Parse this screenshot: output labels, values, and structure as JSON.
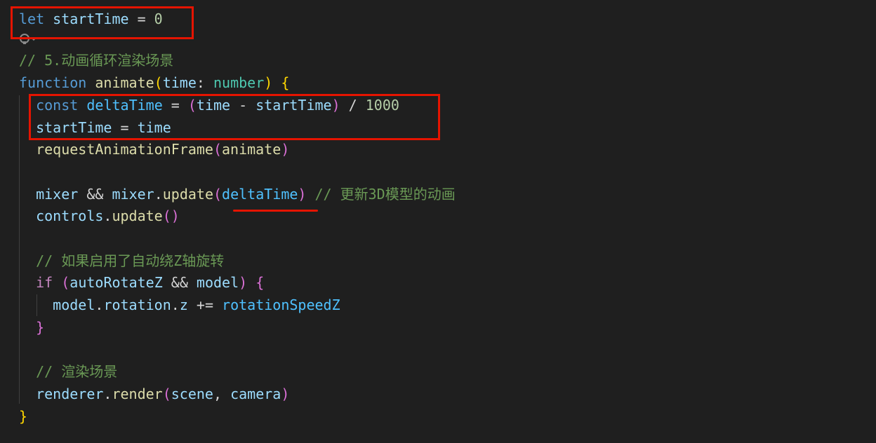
{
  "editor": {
    "lines": [
      {
        "name": "code-line-let-starttime",
        "tokens": [
          {
            "t": "let",
            "c": "kw"
          },
          {
            "t": " ",
            "c": "op"
          },
          {
            "t": "startTime",
            "c": "var"
          },
          {
            "t": " = ",
            "c": "op"
          },
          {
            "t": "0",
            "c": "num"
          }
        ]
      },
      {
        "name": "code-line-comment-animate",
        "tokens": [
          {
            "t": "// 5.动画循环渲染场景",
            "c": "cmt"
          }
        ]
      },
      {
        "name": "code-line-function-animate",
        "tokens": [
          {
            "t": "function",
            "c": "kw"
          },
          {
            "t": " ",
            "c": "op"
          },
          {
            "t": "animate",
            "c": "fn"
          },
          {
            "t": "(",
            "c": "p1"
          },
          {
            "t": "time",
            "c": "var"
          },
          {
            "t": ": ",
            "c": "op"
          },
          {
            "t": "number",
            "c": "type"
          },
          {
            "t": ")",
            "c": "p1"
          },
          {
            "t": " ",
            "c": "op"
          },
          {
            "t": "{",
            "c": "p1"
          }
        ]
      },
      {
        "name": "code-line-const-deltatime",
        "tokens": [
          {
            "t": "  ",
            "c": "op"
          },
          {
            "t": "const",
            "c": "kw"
          },
          {
            "t": " ",
            "c": "op"
          },
          {
            "t": "deltaTime",
            "c": "prop"
          },
          {
            "t": " = ",
            "c": "op"
          },
          {
            "t": "(",
            "c": "p2"
          },
          {
            "t": "time",
            "c": "var"
          },
          {
            "t": " - ",
            "c": "op"
          },
          {
            "t": "startTime",
            "c": "var"
          },
          {
            "t": ")",
            "c": "p2"
          },
          {
            "t": " / ",
            "c": "op"
          },
          {
            "t": "1000",
            "c": "num"
          }
        ]
      },
      {
        "name": "code-line-starttime-assign",
        "tokens": [
          {
            "t": "  ",
            "c": "op"
          },
          {
            "t": "startTime",
            "c": "var"
          },
          {
            "t": " = ",
            "c": "op"
          },
          {
            "t": "time",
            "c": "var"
          }
        ]
      },
      {
        "name": "code-line-request-animation-frame",
        "tokens": [
          {
            "t": "  ",
            "c": "op"
          },
          {
            "t": "requestAnimationFrame",
            "c": "fn"
          },
          {
            "t": "(",
            "c": "p2"
          },
          {
            "t": "animate",
            "c": "fn"
          },
          {
            "t": ")",
            "c": "p2"
          }
        ]
      },
      {
        "name": "code-line-empty",
        "tokens": []
      },
      {
        "name": "code-line-mixer-update",
        "tokens": [
          {
            "t": "  ",
            "c": "op"
          },
          {
            "t": "mixer",
            "c": "var"
          },
          {
            "t": " && ",
            "c": "op"
          },
          {
            "t": "mixer",
            "c": "var"
          },
          {
            "t": ".",
            "c": "op"
          },
          {
            "t": "update",
            "c": "fn"
          },
          {
            "t": "(",
            "c": "p2"
          },
          {
            "t": "deltaTime",
            "c": "prop"
          },
          {
            "t": ")",
            "c": "p2"
          },
          {
            "t": " // 更新3D模型的动画",
            "c": "cmt"
          }
        ]
      },
      {
        "name": "code-line-controls-update",
        "tokens": [
          {
            "t": "  ",
            "c": "op"
          },
          {
            "t": "controls",
            "c": "var"
          },
          {
            "t": ".",
            "c": "op"
          },
          {
            "t": "update",
            "c": "fn"
          },
          {
            "t": "()",
            "c": "p2"
          }
        ]
      },
      {
        "name": "code-line-empty",
        "tokens": []
      },
      {
        "name": "code-line-comment-rotate",
        "tokens": [
          {
            "t": "  ",
            "c": "op"
          },
          {
            "t": "// 如果启用了自动绕Z轴旋转",
            "c": "cmt"
          }
        ]
      },
      {
        "name": "code-line-if-autorotate",
        "tokens": [
          {
            "t": "  ",
            "c": "op"
          },
          {
            "t": "if",
            "c": "ctl"
          },
          {
            "t": " ",
            "c": "op"
          },
          {
            "t": "(",
            "c": "p2"
          },
          {
            "t": "autoRotateZ",
            "c": "var"
          },
          {
            "t": " && ",
            "c": "op"
          },
          {
            "t": "model",
            "c": "var"
          },
          {
            "t": ")",
            "c": "p2"
          },
          {
            "t": " ",
            "c": "op"
          },
          {
            "t": "{",
            "c": "p2"
          }
        ]
      },
      {
        "name": "code-line-rotation-increment",
        "tokens": [
          {
            "t": "    ",
            "c": "op"
          },
          {
            "t": "model",
            "c": "var"
          },
          {
            "t": ".",
            "c": "op"
          },
          {
            "t": "rotation",
            "c": "var"
          },
          {
            "t": ".",
            "c": "op"
          },
          {
            "t": "z",
            "c": "var"
          },
          {
            "t": " += ",
            "c": "op"
          },
          {
            "t": "rotationSpeedZ",
            "c": "prop"
          }
        ]
      },
      {
        "name": "code-line-if-close",
        "tokens": [
          {
            "t": "  ",
            "c": "op"
          },
          {
            "t": "}",
            "c": "p2"
          }
        ]
      },
      {
        "name": "code-line-empty",
        "tokens": []
      },
      {
        "name": "code-line-comment-render",
        "tokens": [
          {
            "t": "  ",
            "c": "op"
          },
          {
            "t": "// 渲染场景",
            "c": "cmt"
          }
        ]
      },
      {
        "name": "code-line-renderer-render",
        "tokens": [
          {
            "t": "  ",
            "c": "op"
          },
          {
            "t": "renderer",
            "c": "var"
          },
          {
            "t": ".",
            "c": "op"
          },
          {
            "t": "render",
            "c": "fn"
          },
          {
            "t": "(",
            "c": "p2"
          },
          {
            "t": "scene",
            "c": "var"
          },
          {
            "t": ", ",
            "c": "op"
          },
          {
            "t": "camera",
            "c": "var"
          },
          {
            "t": ")",
            "c": "p2"
          }
        ]
      },
      {
        "name": "code-line-function-close",
        "tokens": [
          {
            "t": "}",
            "c": "p1"
          }
        ]
      }
    ]
  },
  "colors": {
    "background": "#1f1f1f",
    "annotation_red": "#e51400"
  },
  "icons": {
    "lightbulb": "lightbulb-icon"
  }
}
